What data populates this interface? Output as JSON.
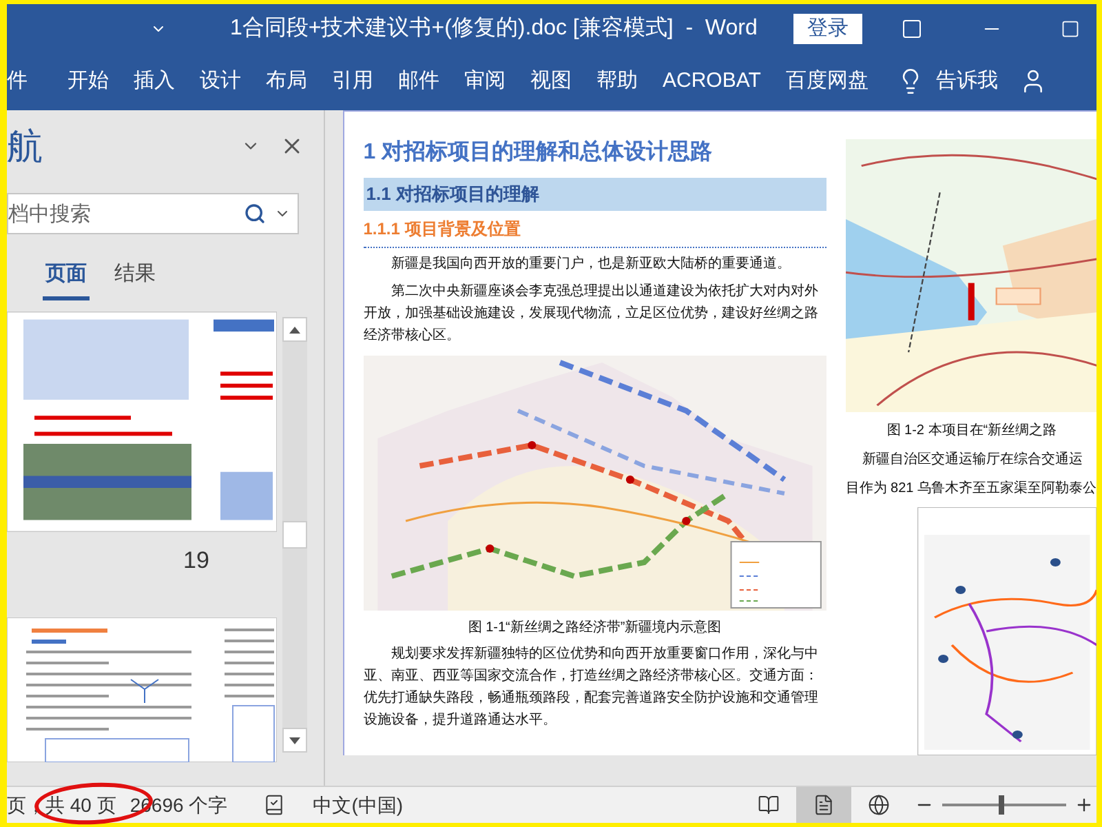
{
  "window": {
    "title": "1合同段+技术建议书+(修复的).doc [兼容模式]  -  Word",
    "sign_in": "登录"
  },
  "ribbon_tabs": [
    "件",
    "开始",
    "插入",
    "设计",
    "布局",
    "引用",
    "邮件",
    "审阅",
    "视图",
    "帮助",
    "ACROBAT",
    "百度网盘"
  ],
  "tell_me": "告诉我",
  "nav_pane": {
    "title": "航",
    "search": {
      "placeholder": "档中搜索"
    },
    "tabs": [
      {
        "label": "页面",
        "selected": true
      },
      {
        "label": "结果",
        "selected": false
      }
    ],
    "page_label": "19"
  },
  "document": {
    "heading1": "1 对招标项目的理解和总体设计思路",
    "heading2": "1.1 对招标项目的理解",
    "heading3": "1.1.1 项目背景及位置",
    "paragraphs": [
      "新疆是我国向西开放的重要门户，也是新亚欧大陆桥的重要通道。",
      "第二次中央新疆座谈会李克强总理提出以通道建设为依托扩大对内对外开放，加强基础设施建设，发展现代物流，立足区位优势，建设好丝绸之路经济带核心区。"
    ],
    "caption": "图 1-1“新丝绸之路经济带”新疆境内示意图",
    "paragraphs_after": [
      "规划要求发挥新疆独特的区位优势和向西开放重要窗口作用，深化与中亚、南亚、西亚等国家交流合作，打造丝绸之路经济带核心区。交通方面：优先打通缺失路段，畅通瓶颈路段，配套完善道路安全防护设施和交通管理设施设备，提升道路通达水平。"
    ],
    "side_caption": "图 1-2 本项目在“新丝绸之路",
    "side_lines": [
      "新疆自治区交通运输厅在综合交通运",
      "目作为 821 乌鲁木齐至五家渠至阿勒泰公"
    ]
  },
  "status_bar": {
    "pages": "页，共 40 页",
    "words": "26696 个字",
    "language": "中文(中国)",
    "views": [
      {
        "kind": "read",
        "selected": false
      },
      {
        "kind": "print",
        "selected": true
      },
      {
        "kind": "web",
        "selected": false
      }
    ],
    "zoom": {
      "level": 0.48
    }
  }
}
